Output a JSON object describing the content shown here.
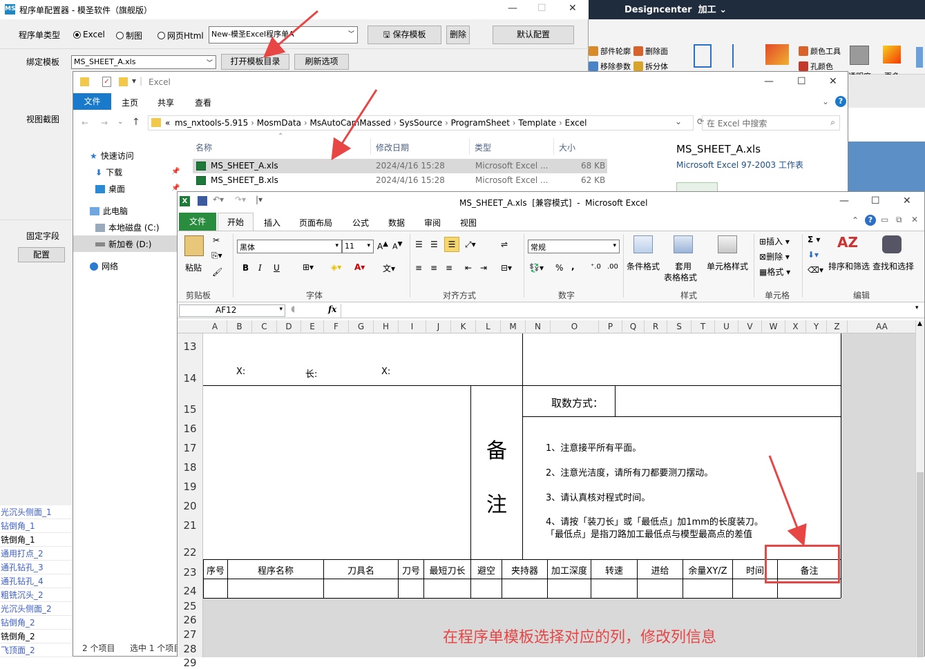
{
  "nx": {
    "title": "Designcenter",
    "menu": "加工",
    "ribbon": {
      "part_outline": "部件轮廓",
      "delete_face": "删除面",
      "remove_params": "移除参数",
      "split_body": "拆分体",
      "color_tool": "颜色工具",
      "hole_color": "孔颜色",
      "transparency": "透明度",
      "more": "更多"
    }
  },
  "configurator": {
    "title": "程序单配置器 - 模圣软件（旗舰版）",
    "logo_text": "MS",
    "type_label": "程序单类型",
    "radio_excel": "Excel",
    "radio_drawing": "制图",
    "radio_html": "网页Html",
    "program_combo": "New-模圣Excel程序单A",
    "save_template": "保存模板",
    "delete": "删除",
    "default_config": "默认配置",
    "bind_template_label": "绑定模板",
    "template_combo": "MS_SHEET_A.xls",
    "open_template_dir": "打开模板目录",
    "refresh_options": "刷新选项",
    "view_screenshot_label": "视图截图",
    "fixed_field_label": "固定字段",
    "config_button": "配置",
    "list_items": [
      {
        "label": "光沉头侧面_1",
        "color": "blue"
      },
      {
        "label": "钻倒角_1",
        "color": "blue"
      },
      {
        "label": "铣倒角_1",
        "color": "black"
      },
      {
        "label": "通用打点_2",
        "color": "blue"
      },
      {
        "label": "通孔钻孔_3",
        "color": "blue"
      },
      {
        "label": "通孔钻孔_4",
        "color": "blue"
      },
      {
        "label": "粗铣沉头_2",
        "color": "blue"
      },
      {
        "label": "光沉头侧面_2",
        "color": "blue"
      },
      {
        "label": "钻倒角_2",
        "color": "blue"
      },
      {
        "label": "铣倒角_2",
        "color": "black"
      },
      {
        "label": "飞顶面_2",
        "color": "blue"
      }
    ]
  },
  "explorer": {
    "title": "Excel",
    "menu": {
      "file": "文件",
      "home": "主页",
      "share": "共享",
      "view": "查看"
    },
    "address": [
      "ms_nxtools-5.915",
      "MosmData",
      "MsAutoCamMassed",
      "SysSource",
      "ProgramSheet",
      "Template",
      "Excel"
    ],
    "address_prefix": "«",
    "search_placeholder": "在 Excel 中搜索",
    "nav": {
      "quick_access": "快速访问",
      "downloads": "下载",
      "desktop": "桌面",
      "this_pc": "此电脑",
      "local_disk": "本地磁盘 (C:)",
      "new_volume": "新加卷 (D:)",
      "network": "网络"
    },
    "columns": {
      "name": "名称",
      "modified": "修改日期",
      "type": "类型",
      "size": "大小"
    },
    "files": [
      {
        "name": "MS_SHEET_A.xls",
        "modified": "2024/4/16 15:28",
        "type": "Microsoft Excel ...",
        "size": "68 KB"
      },
      {
        "name": "MS_SHEET_B.xls",
        "modified": "2024/4/16 15:28",
        "type": "Microsoft Excel ...",
        "size": "62 KB"
      }
    ],
    "preview_name": "MS_SHEET_A.xls",
    "preview_type": "Microsoft Excel 97-2003 工作表",
    "status_count": "2 个项目",
    "status_selected": "选中 1 个项目"
  },
  "excel": {
    "title": "MS_SHEET_A.xls  [兼容模式]  -  Microsoft Excel",
    "tabs": {
      "file": "文件",
      "home": "开始",
      "insert": "插入",
      "layout": "页面布局",
      "formulas": "公式",
      "data": "数据",
      "review": "审阅",
      "view": "视图"
    },
    "ribbon": {
      "paste": "粘贴",
      "clipboard": "剪贴板",
      "font_name": "黑体",
      "font_size": "11",
      "font_group": "字体",
      "bold": "B",
      "italic": "I",
      "underline": "U",
      "align_group": "对齐方式",
      "number_format": "常规",
      "number_group": "数字",
      "percent": "%",
      "comma": ",",
      "cond_format": "条件格式",
      "table_format_1": "套用",
      "table_format_2": "表格格式",
      "cell_style": "单元格样式",
      "style_group": "样式",
      "insert": "插入",
      "delete": "删除",
      "format": "格式",
      "cells_group": "单元格",
      "sigma": "Σ",
      "sort_filter": "排序和筛选",
      "find_select": "查找和选择",
      "edit_group": "编辑"
    },
    "name_box": "AF12",
    "fx": "fx",
    "columns": [
      "A",
      "B",
      "C",
      "D",
      "E",
      "F",
      "G",
      "H",
      "I",
      "J",
      "K",
      "L",
      "M",
      "N",
      "O",
      "P",
      "Q",
      "R",
      "S",
      "T",
      "U",
      "V",
      "W",
      "X",
      "Y",
      "Z",
      "AA"
    ],
    "rows": [
      "13",
      "14",
      "15",
      "16",
      "17",
      "18",
      "19",
      "20",
      "21",
      "22",
      "23",
      "24",
      "25",
      "26",
      "27",
      "28",
      "29"
    ],
    "cells": {
      "x1": "X:",
      "len": "长:",
      "x2": "X:",
      "fetch_mode": "取数方式：",
      "remark_big_1": "备",
      "remark_big_2": "注",
      "note1": "1、注意接平所有平面。",
      "note2": "2、注意光洁度，请所有刀都要测刀摆动。",
      "note3": "3、请认真核对程式时间。",
      "note4a": "4、请按「装刀长」或「最低点」加1mm的长度装刀。",
      "note4b": "「最低点」是指刀路加工最低点与模型最高点的差值"
    },
    "header_row": [
      "序号",
      "程序名称",
      "刀具名",
      "刀号",
      "最短刀长",
      "避空",
      "夹持器",
      "加工深度",
      "转速",
      "进给",
      "余量XY/Z",
      "时间",
      "备注"
    ]
  },
  "annotation": {
    "caption": "在程序单模板选择对应的列，修改列信息",
    "color": "#e84545"
  }
}
